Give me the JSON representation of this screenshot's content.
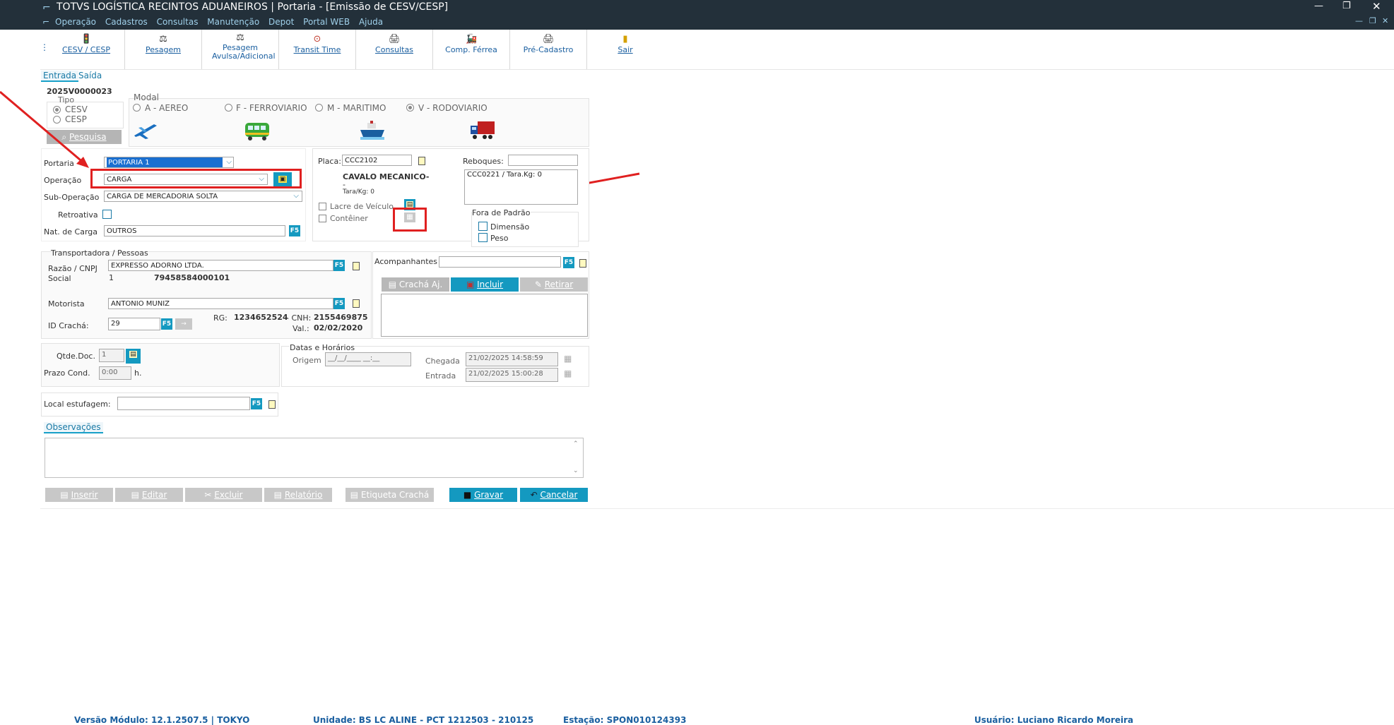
{
  "window": {
    "title": "TOTVS LOGÍSTICA RECINTOS ADUANEIROS | Portaria - [Emissão de CESV/CESP]",
    "menu": [
      "Operação",
      "Cadastros",
      "Consultas",
      "Manutenção",
      "Depot",
      "Portal WEB",
      "Ajuda"
    ]
  },
  "toolbar": [
    {
      "label": "CESV / CESP",
      "icon": "traffic-light-icon"
    },
    {
      "label": "Pesagem",
      "icon": "scale-icon"
    },
    {
      "label": "Pesagem Avulsa/Adicional",
      "icon": "scale-icon"
    },
    {
      "label": "Transit Time",
      "icon": "clock-icon"
    },
    {
      "label": "Consultas",
      "icon": "printer-icon"
    },
    {
      "label": "Comp. Férrea",
      "icon": "train-icon"
    },
    {
      "label": "Pré-Cadastro",
      "icon": "printer-icon"
    },
    {
      "label": "Sair",
      "icon": "exit-door-icon"
    }
  ],
  "tabs": {
    "entrada": "Entrada",
    "saida": "Saída"
  },
  "record": {
    "id": "2025V0000023"
  },
  "tipo": {
    "label": "Tipo",
    "options": [
      "CESV",
      "CESP"
    ],
    "search_label": "Pesquisa"
  },
  "modal": {
    "label": "Modal",
    "options": [
      "A - AEREO",
      "F - FERROVIARIO",
      "M - MARITIMO",
      "V - RODOVIARIO"
    ],
    "selected": "V - RODOVIARIO"
  },
  "form": {
    "portaria_label": "Portaria",
    "portaria_value": "PORTARIA 1",
    "operacao_label": "Operação",
    "operacao_value": "CARGA",
    "suboperacao_label": "Sub-Operação",
    "suboperacao_value": "CARGA DE MERCADORIA SOLTA",
    "retroativa_label": "Retroativa",
    "natcarga_label": "Nat. de Carga",
    "natcarga_value": "OUTROS"
  },
  "vehicle": {
    "placa_label": "Placa:",
    "placa_value": "CCC2102",
    "descricao": "CAVALO MECANICO-",
    "dash": "-",
    "tara": "Tara/Kg: 0",
    "lacre_label": "Lacre de Veículo",
    "conteiner_label": "Contêiner",
    "reboques_label": "Reboques:",
    "reboques_list": "CCC0221 / Tara.Kg: 0",
    "fora_padrao_label": "Fora de Padrão",
    "dimensao_label": "Dimensão",
    "peso_label": "Peso"
  },
  "transportadora": {
    "section_label": "Transportadora / Pessoas",
    "razao_label": "Razão / CNPJ",
    "social_label": "Social",
    "razao_value": "EXPRESSO ADORNO LTDA.",
    "cnpj_prefix": "1",
    "cnpj_value": "79458584000101",
    "motorista_label": "Motorista",
    "motorista_value": "ANTONIO MUNIZ",
    "idcracha_label": "ID Crachá:",
    "idcracha_value": "29",
    "rg_label": "RG:",
    "rg_value": "1234652524",
    "cnh_label": "- CNH:",
    "cnh_value": "2155469875",
    "val_label": "Val.:",
    "val_value": "02/02/2020"
  },
  "acompanhantes": {
    "label": "Acompanhantes",
    "cracha_btn": "Crachá Aj.",
    "incluir_btn": "Incluir",
    "retirar_btn": "Retirar"
  },
  "docs": {
    "qtde_label": "Qtde.Doc.",
    "qtde_value": "1",
    "prazo_label": "Prazo Cond.",
    "prazo_value": "0:00",
    "prazo_unit": "h."
  },
  "datas": {
    "section_label": "Datas e Horários",
    "origem_label": "Origem",
    "origem_value": "__/__/____ __:__",
    "chegada_label": "Chegada",
    "chegada_value": "21/02/2025 14:58:59",
    "entrada_label": "Entrada",
    "entrada_value": "21/02/2025 15:00:28"
  },
  "local": {
    "label": "Local estufagem:",
    "value": ""
  },
  "observacoes": {
    "label": "Observações",
    "value": ""
  },
  "actions": {
    "inserir": "Inserir",
    "editar": "Editar",
    "excluir": "Excluir",
    "relatorio": "Relatório",
    "etiqueta": "Etiqueta Crachá",
    "gravar": "Gravar",
    "cancelar": "Cancelar"
  },
  "status": {
    "versao": "Versão Módulo:   12.1.2507.5  |  TOKYO",
    "unidade": "Unidade: BS LC ALINE - PCT 1212503 - 210125",
    "estacao": "Estação: SPON010124393",
    "usuario": "Usuário: Luciano Ricardo Moreira"
  }
}
